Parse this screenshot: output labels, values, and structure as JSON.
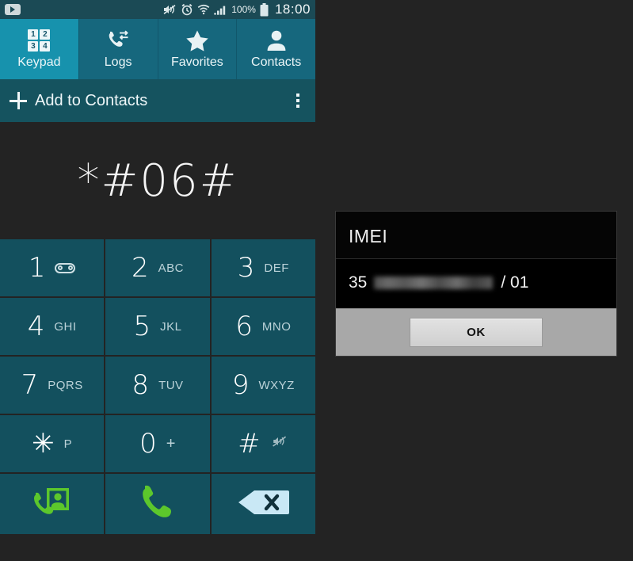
{
  "statusbar": {
    "notification_icon": "youtube-icon",
    "icons": [
      "sound-mute-icon",
      "alarm-clock-icon",
      "wifi-icon",
      "signal-bars-icon"
    ],
    "battery_percent": "100%",
    "battery_icon": "battery-full-icon",
    "clock": "18:00"
  },
  "tabs": [
    {
      "label": "Keypad",
      "icon": "keypad-grid-icon",
      "selected": true
    },
    {
      "label": "Logs",
      "icon": "call-logs-icon",
      "selected": false
    },
    {
      "label": "Favorites",
      "icon": "star-icon",
      "selected": false
    },
    {
      "label": "Contacts",
      "icon": "person-icon",
      "selected": false
    }
  ],
  "keypad_tab_icon_digits": [
    "1",
    "2",
    "3",
    "4"
  ],
  "actionbar": {
    "add_label": "Add to Contacts",
    "plus_icon": "plus-icon",
    "overflow_icon": "overflow-menu-icon"
  },
  "dial": {
    "number": "*#06#"
  },
  "keys": [
    {
      "digit": "1",
      "sub": "",
      "icon": "voicemail-icon"
    },
    {
      "digit": "2",
      "sub": "ABC",
      "icon": ""
    },
    {
      "digit": "3",
      "sub": "DEF",
      "icon": ""
    },
    {
      "digit": "4",
      "sub": "GHI",
      "icon": ""
    },
    {
      "digit": "5",
      "sub": "JKL",
      "icon": ""
    },
    {
      "digit": "6",
      "sub": "MNO",
      "icon": ""
    },
    {
      "digit": "7",
      "sub": "PQRS",
      "icon": ""
    },
    {
      "digit": "8",
      "sub": "TUV",
      "icon": ""
    },
    {
      "digit": "9",
      "sub": "WXYZ",
      "icon": ""
    },
    {
      "digit": "✳",
      "sub": "P",
      "icon": ""
    },
    {
      "digit": "0",
      "sub": "+",
      "icon": ""
    },
    {
      "digit": "#",
      "sub": "",
      "icon": "mute-icon"
    }
  ],
  "actions": [
    {
      "name": "video-call-button",
      "icon": "video-call-icon"
    },
    {
      "name": "call-button",
      "icon": "phone-call-icon"
    },
    {
      "name": "backspace-button",
      "icon": "backspace-icon"
    }
  ],
  "dialog": {
    "title": "IMEI",
    "imei_prefix": "35",
    "imei_redacted": "redacted-imei-digits",
    "imei_suffix": "/ 01",
    "ok_label": "OK"
  },
  "colors": {
    "background": "#232323",
    "status_bar": "#1b4a55",
    "tab_bar": "#16677d",
    "tab_selected": "#1792ad",
    "key": "#13505e",
    "action_green": "#5cc72c",
    "backspace_blue": "#c9e8f5",
    "dialog_footer": "#a8a8a8"
  }
}
